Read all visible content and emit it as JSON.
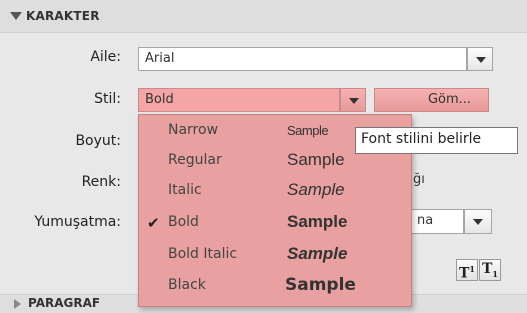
{
  "section": {
    "title": "KARAKTER"
  },
  "labels": {
    "family": "Aile:",
    "style": "Stil:",
    "size": "Boyut:",
    "color": "Renk:",
    "smoothing": "Yumuşatma:"
  },
  "family_select": {
    "value": "Arial"
  },
  "style_select": {
    "value": "Bold"
  },
  "embed_button": {
    "label": "Göm..."
  },
  "tooltip": {
    "text": "Font stilini belirle"
  },
  "partial": {
    "renk_suffix": "ğı",
    "smoothing_value": "na"
  },
  "dropdown": {
    "items": [
      {
        "name": "Narrow",
        "sample": "Sample",
        "checked": false
      },
      {
        "name": "Regular",
        "sample": "Sample",
        "checked": false
      },
      {
        "name": "Italic",
        "sample": "Sample",
        "checked": false
      },
      {
        "name": "Bold",
        "sample": "Sample",
        "checked": true
      },
      {
        "name": "Bold Italic",
        "sample": "Sample",
        "checked": false
      },
      {
        "name": "Black",
        "sample": "Sample",
        "checked": false
      }
    ],
    "check_glyph": "✔"
  },
  "script_buttons": {
    "superscript": "T",
    "subscript": "T",
    "super_mark": "1",
    "sub_mark": "1"
  },
  "section2": {
    "title": "PARAGRAF"
  },
  "colors": {
    "dropdown_bg": "#e8a0a0",
    "selected_field": "#f5a5a5"
  }
}
